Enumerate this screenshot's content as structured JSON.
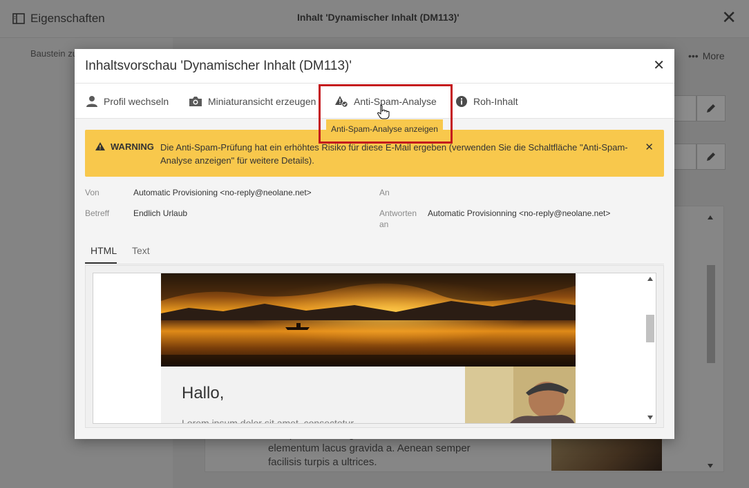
{
  "background": {
    "panel_title": "Eigenschaften",
    "window_title": "Inhalt 'Dynamischer Inhalt (DM113)'",
    "side_text": "Baustein zum Speichern aus",
    "more_label": "More",
    "body_text": "Sed placerat, integer ultrices interdum nisi, sed elementum lacus gravida a. Aenean semper facilisis turpis a ultrices."
  },
  "modal": {
    "title": "Inhaltsvorschau 'Dynamischer Inhalt (DM113)'",
    "toolbar": {
      "profile": "Profil wechseln",
      "thumbnail": "Miniaturansicht erzeugen",
      "antispam": "Anti-Spam-Analyse",
      "raw": "Roh-Inhalt"
    },
    "tooltip": "Anti-Spam-Analyse anzeigen",
    "warning": {
      "label": "WARNING",
      "text": "Die Anti-Spam-Prüfung hat ein erhöhtes Risiko für diese E-Mail ergeben (verwenden Sie die Schaltfläche \"Anti-Spam-Analyse anzeigen\" für weitere Details)."
    },
    "meta": {
      "from_label": "Von",
      "from_value": "Automatic Provisioning <no-reply@neolane.net>",
      "subject_label": "Betreff",
      "subject_value": "Endlich Urlaub",
      "to_label": "An",
      "to_value": "",
      "reply_label_1": "Antworten",
      "reply_label_2": "an",
      "reply_value": "Automatic Provisionning <no-reply@neolane.net>"
    },
    "tabs": [
      "HTML",
      "Text"
    ],
    "active_tab": "HTML",
    "email": {
      "greeting": "Hallo,",
      "lorem": "Lorem ipsum dolor sit amet, consectetur"
    }
  },
  "colors": {
    "warning_bg": "#f8c84c",
    "highlight_border": "#c4161c",
    "overlay": "rgba(0,0,0,0.45)"
  }
}
